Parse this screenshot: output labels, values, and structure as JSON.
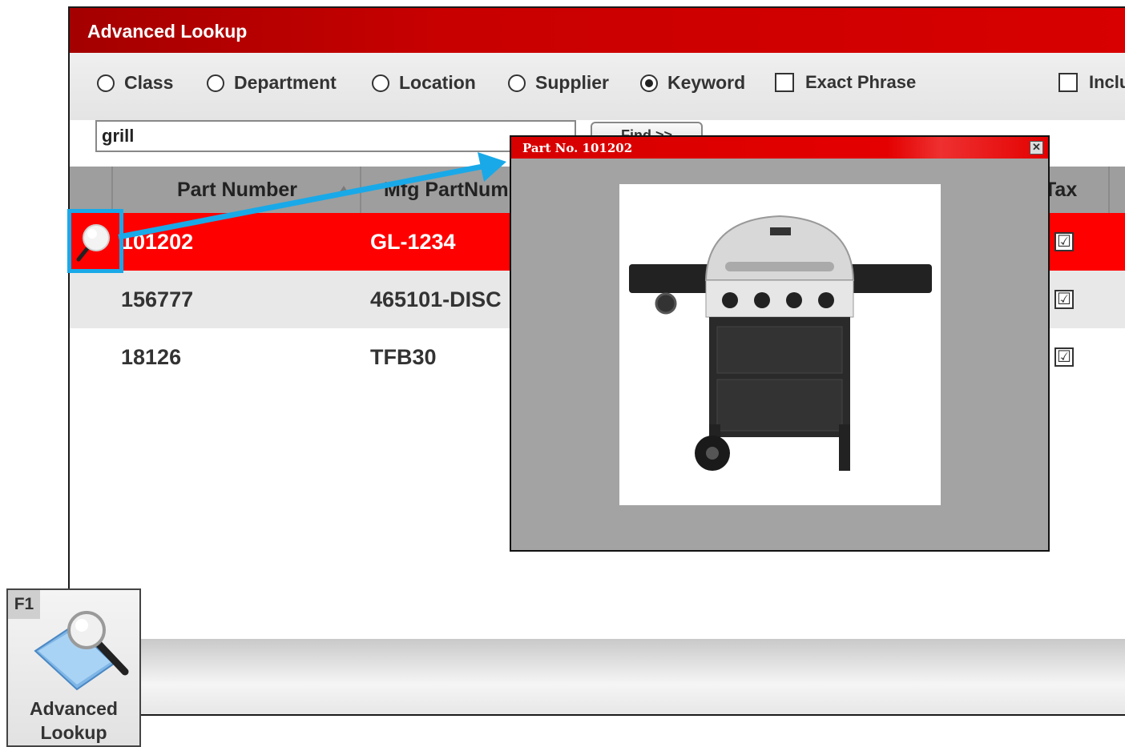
{
  "window": {
    "title": "Advanced Lookup"
  },
  "options": {
    "radios": [
      {
        "label": "Class",
        "selected": false
      },
      {
        "label": "Department",
        "selected": false
      },
      {
        "label": "Location",
        "selected": false
      },
      {
        "label": "Supplier",
        "selected": false
      },
      {
        "label": "Keyword",
        "selected": true
      }
    ],
    "exact_phrase_label": "Exact Phrase",
    "include_label": "Inclu"
  },
  "search": {
    "value": "grill",
    "find_label": "Find >>"
  },
  "table": {
    "headers": [
      "Part Number",
      "Mfg PartNum",
      "Tax"
    ],
    "rows": [
      {
        "part": "101202",
        "mfg": "GL-1234",
        "tax": "☑",
        "selected": true
      },
      {
        "part": "156777",
        "mfg": "465101-DISC",
        "tax": "☑",
        "selected": false
      },
      {
        "part": "18126",
        "mfg": "TFB30",
        "tax": "☑",
        "selected": false
      }
    ]
  },
  "popup": {
    "title": "Part No. 101202",
    "close_glyph": "✕"
  },
  "f1_button": {
    "key": "F1",
    "label_line1": "Advanced",
    "label_line2": "Lookup"
  },
  "colors": {
    "brand_red": "#d80000",
    "selected_row": "#ff0000",
    "highlight": "#19a9e8"
  }
}
